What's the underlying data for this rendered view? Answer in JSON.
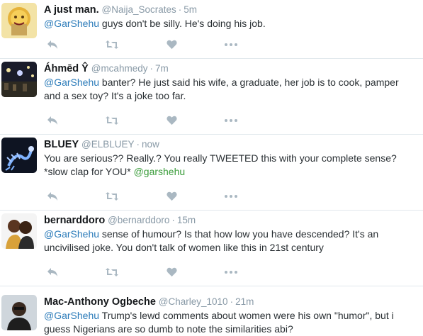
{
  "colors": {
    "mention": "#2b7bb9",
    "mention_alt": "#3a9c3a",
    "muted": "#8899a6",
    "icon": "#aab8c2",
    "divider": "#e1e8ed"
  },
  "icons": [
    "reply-icon",
    "retweet-icon",
    "like-icon",
    "more-icon"
  ],
  "tweets": [
    {
      "name": "A just man.",
      "handle": "@Naija_Socrates",
      "dot": "·",
      "time": "5m",
      "lines": [
        {
          "mention": "@GarShehu",
          "text": " guys don't be silly. He's doing his job."
        }
      ]
    },
    {
      "name": "Áhmēd Ŷ",
      "handle": "@mcahmedy",
      "dot": "·",
      "time": "7m",
      "lines": [
        {
          "mention": "@GarShehu",
          "text": " banter? He just said his wife, a graduate, her job is to cook, pamper"
        },
        {
          "text": "and a sex toy? It's a joke too far."
        }
      ]
    },
    {
      "name": "BLUEY",
      "handle": "@ELBLUEY",
      "dot": "·",
      "time": "now",
      "lines": [
        {
          "text": "You are serious?? Really.? You really TWEETED this with your complete sense?"
        },
        {
          "text": "*slow clap for YOU* ",
          "mention_after": "@garshehu"
        }
      ]
    },
    {
      "name": "bernarddoro",
      "handle": "@bernarddoro",
      "dot": "·",
      "time": "15m",
      "lines": [
        {
          "mention": "@GarShehu",
          "text": " sense of humour? Is that how low you have descended? It's an"
        },
        {
          "text": "uncivilised joke. You don't talk of women like this in 21st century"
        }
      ]
    },
    {
      "name": "Mac-Anthony Ogbeche",
      "handle": "@Charley_1010",
      "dot": "·",
      "time": "21m",
      "lines": [
        {
          "mention": "@GarShehu",
          "text": " Trump's lewd comments about women were his own \"humor\", but i"
        },
        {
          "text": "guess Nigerians are so dumb to note the similarities abi?"
        }
      ]
    }
  ]
}
